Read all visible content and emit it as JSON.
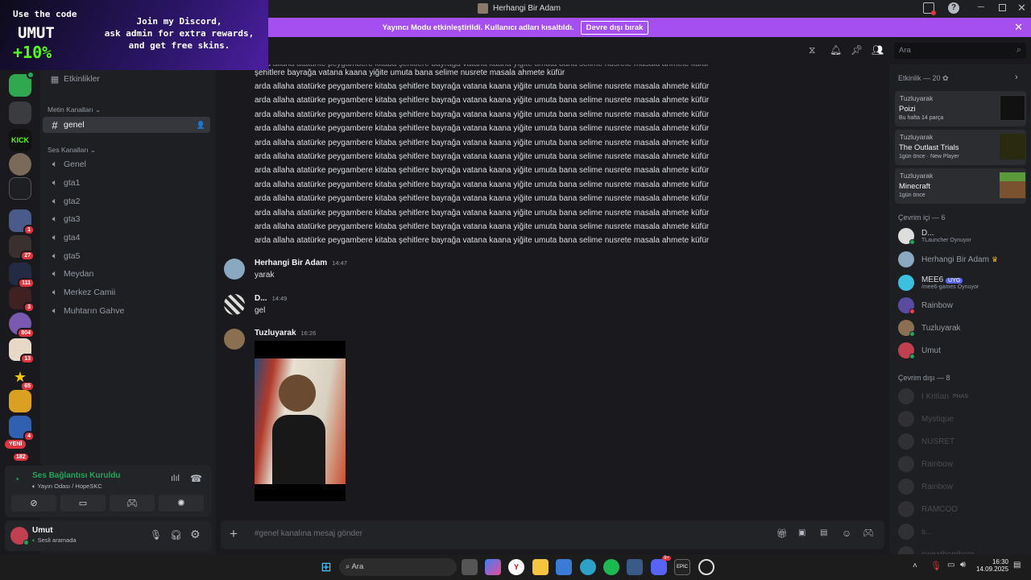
{
  "window": {
    "title": "Herhangi Bir Adam"
  },
  "overlay": {
    "code_line": "Use the code",
    "code": "UMUT",
    "bonus": "+10%",
    "discord_text": "Join my Discord,\nask admin for extra rewards,\nand get free skins."
  },
  "banner": {
    "text": "Yayıncı Modu etkinleştirildi. Kullanıcı adları kısaltıldı.",
    "button": "Devre dışı bırak"
  },
  "rail": {
    "kick": "KICK",
    "new": "YENİ",
    "badges": [
      "1",
      "27",
      "111",
      "3",
      "804",
      "13",
      "65",
      "4",
      "182"
    ]
  },
  "channels": {
    "events": "Etkinlikler",
    "text_category": "Metin Kanalları",
    "text_channels": [
      "genel"
    ],
    "voice_category": "Ses Kanalları",
    "voice_channels": [
      "Genel",
      "gta1",
      "gta2",
      "gta3",
      "gta4",
      "gta5",
      "Meydan",
      "Merkez Camii",
      "Muhtarın Gahve"
    ]
  },
  "voice_panel": {
    "status": "Ses Bağlantısı Kuruldu",
    "location": "Yayın Odası / HopeSKC"
  },
  "user_panel": {
    "name": "Umut",
    "status": "Sesli aramada"
  },
  "toolbar": {
    "search_placeholder": "Ara"
  },
  "chat": {
    "partial_line": "şehitlere bayrağa vatana kaana yiğite umuta bana selime nusrete masala ahmete küfür",
    "repeated_line": "arda allaha atatürke peygambere kitaba şehitlere bayrağa vatana kaana yiğite umuta bana selime nusrete masala ahmete küfür",
    "messages": [
      {
        "author": "Herhangi Bir Adam",
        "time": "14:47",
        "text": "yarak"
      },
      {
        "author": "D...",
        "time": "14:49",
        "text": "gel"
      },
      {
        "author": "Tuzluyarak",
        "time": "16:26",
        "text": ""
      }
    ]
  },
  "composer": {
    "placeholder": "#genel kanalına mesaj gönder"
  },
  "members": {
    "activity_header": "Etkinlik — 20",
    "activities": [
      {
        "user": "Tuzluyarak",
        "title": "Poizi",
        "sub": "Bu hafta 14 parça",
        "extra": ""
      },
      {
        "user": "Tuzluyarak",
        "title": "The Outlast Trials",
        "sub": "1gün önce",
        "extra": "New Player"
      },
      {
        "user": "Tuzluyarak",
        "title": "Minecraft",
        "sub": "1gün önce",
        "extra": ""
      }
    ],
    "online_header": "Çevrim içi — 6",
    "online": [
      {
        "name": "D...",
        "sub": "TLauncher Oynuyor",
        "tag": ""
      },
      {
        "name": "Herhangi Bir Adam",
        "sub": "",
        "tag": ""
      },
      {
        "name": "MEE6",
        "sub": "/mee6-games Oynuyor",
        "tag": "UYG"
      },
      {
        "name": "Rainbow",
        "sub": "",
        "tag": ""
      },
      {
        "name": "Tuzluyarak",
        "sub": "",
        "tag": ""
      },
      {
        "name": "Umut",
        "sub": "",
        "tag": ""
      }
    ],
    "offline_header": "Çevrim dışı — 8",
    "offline": [
      {
        "name": "I Kritian",
        "tag": "PHAS"
      },
      {
        "name": "Mystique",
        "tag": ""
      },
      {
        "name": "NUSRET",
        "tag": ""
      },
      {
        "name": "Rainbow",
        "tag": ""
      },
      {
        "name": "Rainbow",
        "tag": ""
      },
      {
        "name": "RAMCOO",
        "tag": ""
      },
      {
        "name": "s...",
        "tag": ""
      },
      {
        "name": "sweatbomborp",
        "tag": ""
      }
    ]
  },
  "taskbar": {
    "search": "Ara",
    "time": "16:30",
    "date": "14.09.2025",
    "discord_badge": "9+"
  }
}
